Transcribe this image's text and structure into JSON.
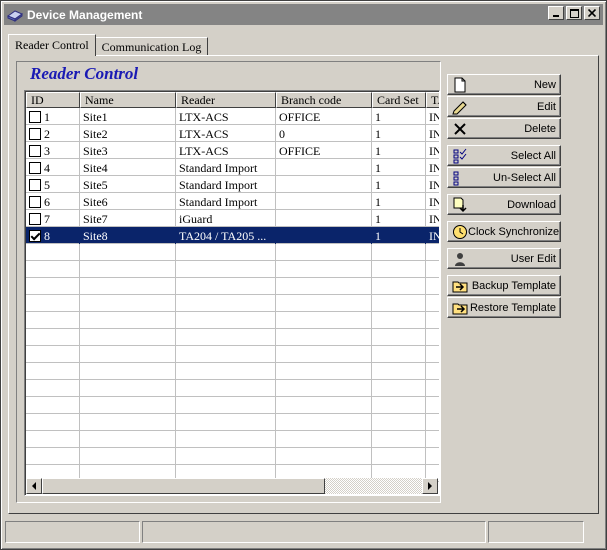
{
  "window": {
    "title": "Device Management"
  },
  "tabs": [
    {
      "label": "Reader Control",
      "active": true
    },
    {
      "label": "Communication Log",
      "active": false
    }
  ],
  "group_title": "Reader Control",
  "grid": {
    "columns": [
      "ID",
      "Name",
      "Reader",
      "Branch code",
      "Card Set",
      "TA"
    ],
    "rows": [
      {
        "id": "1",
        "name": "Site1",
        "reader": "LTX-ACS",
        "branch": "OFFICE",
        "card_set": "1",
        "ta": "IN",
        "checked": false,
        "selected": false
      },
      {
        "id": "2",
        "name": "Site2",
        "reader": "LTX-ACS",
        "branch": "0",
        "card_set": "1",
        "ta": "IN",
        "checked": false,
        "selected": false
      },
      {
        "id": "3",
        "name": "Site3",
        "reader": "LTX-ACS",
        "branch": "OFFICE",
        "card_set": "1",
        "ta": "IN",
        "checked": false,
        "selected": false
      },
      {
        "id": "4",
        "name": "Site4",
        "reader": "Standard Import",
        "branch": "",
        "card_set": "1",
        "ta": "IN",
        "checked": false,
        "selected": false
      },
      {
        "id": "5",
        "name": "Site5",
        "reader": "Standard Import",
        "branch": "",
        "card_set": "1",
        "ta": "IN",
        "checked": false,
        "selected": false
      },
      {
        "id": "6",
        "name": "Site6",
        "reader": "Standard Import",
        "branch": "",
        "card_set": "1",
        "ta": "IN",
        "checked": false,
        "selected": false
      },
      {
        "id": "7",
        "name": "Site7",
        "reader": "iGuard",
        "branch": "",
        "card_set": "1",
        "ta": "IN",
        "checked": false,
        "selected": false
      },
      {
        "id": "8",
        "name": "Site8",
        "reader": "TA204 / TA205 ...",
        "branch": "",
        "card_set": "1",
        "ta": "IN",
        "checked": true,
        "selected": true
      }
    ]
  },
  "actions": [
    {
      "label": "New",
      "icon": "new-file-icon"
    },
    {
      "label": "Edit",
      "icon": "pencil-icon"
    },
    {
      "label": "Delete",
      "icon": "delete-x-icon"
    },
    {
      "label": "Select All",
      "icon": "select-all-icon"
    },
    {
      "label": "Un-Select All",
      "icon": "unselect-all-icon"
    },
    {
      "label": "Download",
      "icon": "download-icon"
    },
    {
      "label": "Clock Synchronize",
      "icon": "clock-icon"
    },
    {
      "label": "User Edit",
      "icon": "user-icon"
    },
    {
      "label": "Backup Template",
      "icon": "backup-folder-icon"
    },
    {
      "label": "Restore Template",
      "icon": "restore-folder-icon"
    }
  ]
}
